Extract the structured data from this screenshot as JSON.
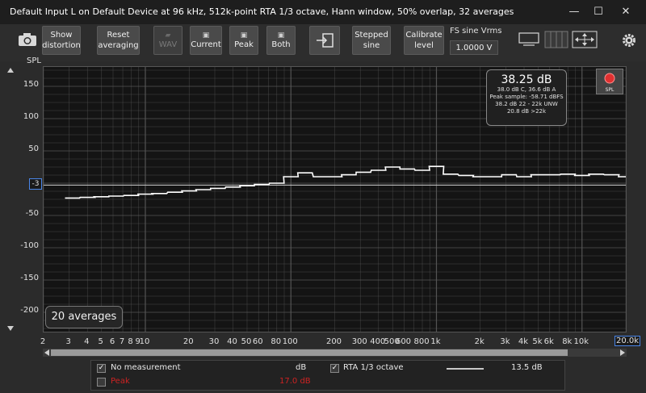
{
  "window": {
    "title": "Default Input L on Default Device at 96 kHz, 512k-point RTA 1/3 octave, Hann window, 50% overlap, 32 averages",
    "minimize": "—",
    "maximize": "☐",
    "close": "✕"
  },
  "toolbar": {
    "show_distortion": [
      "Show",
      "distortion"
    ],
    "reset_averaging": [
      "Reset",
      "averaging"
    ],
    "wav": "WAV",
    "current": "Current",
    "peak": "Peak",
    "both": "Both",
    "stepped_sine": [
      "Stepped",
      "sine"
    ],
    "calibrate_level": [
      "Calibrate",
      "level"
    ],
    "fs_sine_label": "FS sine Vrms",
    "fs_sine_value": "1.0000 V"
  },
  "graph": {
    "y_axis_title": "SPL",
    "y_ticks": [
      "150",
      "100",
      "50",
      "-3",
      "-50",
      "-100",
      "-150",
      "-200"
    ],
    "x_ticks": [
      "2",
      "3",
      "4",
      "5",
      "6",
      "7",
      "8",
      "9",
      "10",
      "20",
      "30",
      "40",
      "50",
      "60",
      "80",
      "100",
      "200",
      "300",
      "400",
      "500",
      "600",
      "800",
      "1k",
      "2k",
      "3k",
      "4k",
      "5k",
      "6k",
      "8k",
      "10k",
      "20.0k"
    ],
    "averages_badge": "20 averages",
    "readout": {
      "main": "38.25 dB",
      "line1": "38.0 dB C, 36.6 dB A",
      "line2": "Peak sample: -58.71 dBFS",
      "line3": "38.2 dB 22 - 22k UNW",
      "line4": "20.8 dB >22k"
    },
    "spl_button": "SPL",
    "colors": {
      "trace": "#ffffff",
      "grid": "#5a5a5a",
      "background": "#141414",
      "peak": "#cc2222"
    }
  },
  "chart_data": {
    "type": "line",
    "title": "",
    "xlabel": "",
    "ylabel": "SPL",
    "x_scale": "log",
    "xlim": [
      2,
      20000
    ],
    "ylim": [
      -230,
      180
    ],
    "grid": true,
    "reference_level": -3,
    "series": [
      {
        "name": "RTA 1/3 octave",
        "x": [
          3.15,
          4,
          5,
          6.3,
          8,
          10,
          12.5,
          16,
          20,
          25,
          31.5,
          40,
          50,
          63,
          80,
          100,
          125,
          160,
          200,
          250,
          315,
          400,
          500,
          630,
          800,
          1000,
          1250,
          1600,
          2000,
          2500,
          3150,
          4000,
          5000,
          6300,
          8000,
          10000,
          12500,
          16000,
          20000
        ],
        "y": [
          -23,
          -22,
          -21,
          -20,
          -19,
          -17,
          -16,
          -14,
          -12,
          -10,
          -8,
          -6,
          -4,
          -2,
          0,
          10,
          16,
          10,
          10,
          13,
          17,
          20,
          25,
          22,
          20,
          26,
          14,
          12,
          10,
          10,
          13,
          10,
          13,
          13,
          14,
          12,
          14,
          13,
          10
        ]
      }
    ]
  },
  "legend": {
    "row1": {
      "name": "No measurement",
      "unit": "dB",
      "name2": "RTA 1/3 octave",
      "value2": "13.5 dB"
    },
    "row2": {
      "name": "Peak",
      "value": "17.0 dB"
    }
  }
}
